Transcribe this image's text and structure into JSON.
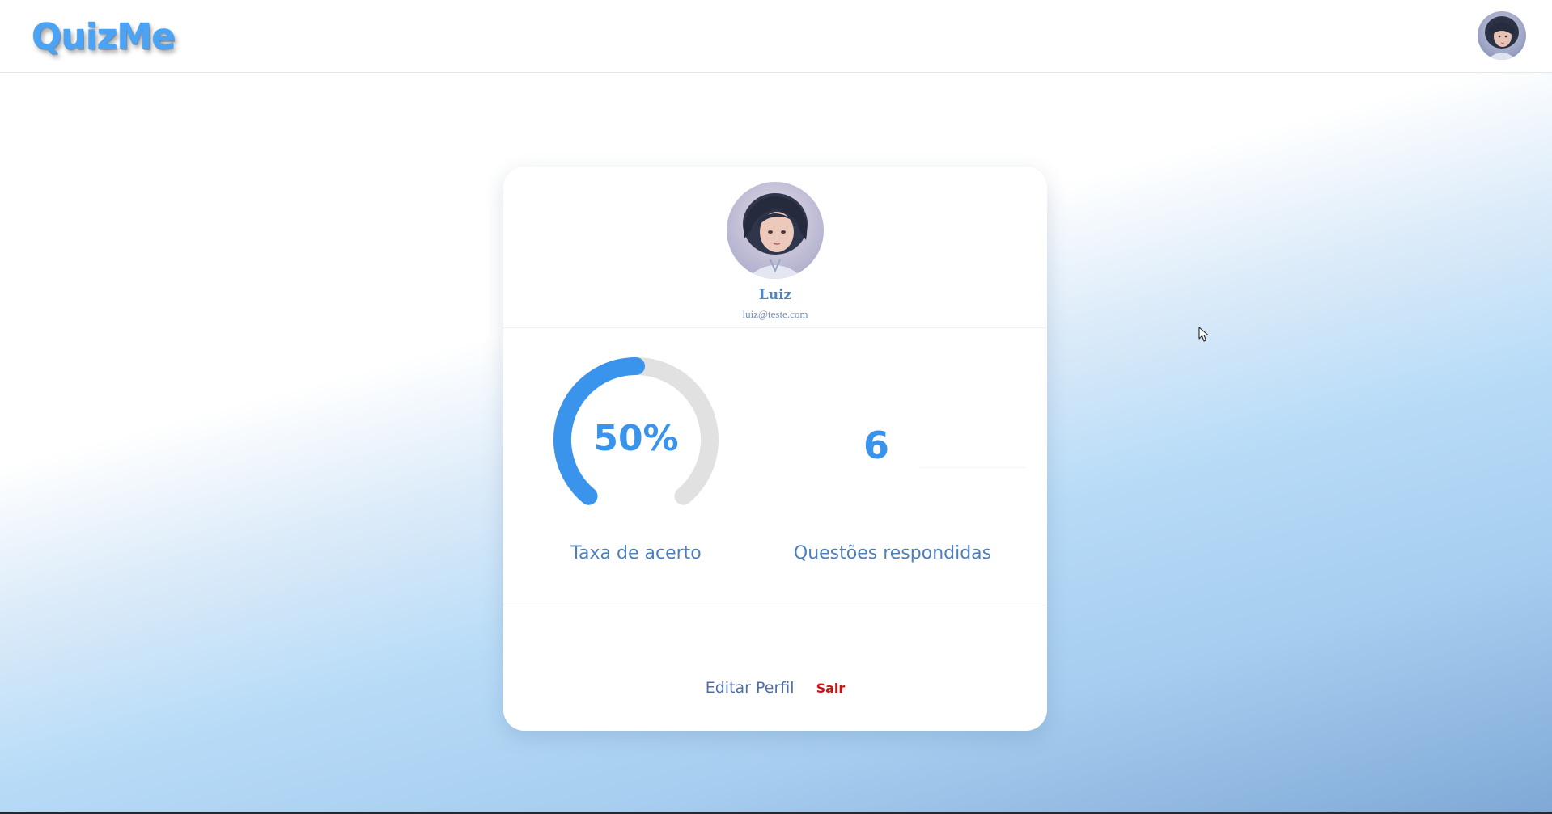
{
  "header": {
    "logo_text": "QuizMe",
    "avatar_icon": "user-avatar-icon"
  },
  "profile": {
    "name": "Luiz",
    "email": "luiz@teste.com",
    "avatar_icon": "profile-avatar-icon"
  },
  "stats": {
    "accuracy": {
      "value_text": "50%",
      "fraction": 0.5,
      "label": "Taxa de acerto"
    },
    "answered": {
      "value_text": "6",
      "label": "Questões respondidas"
    }
  },
  "actions": {
    "edit_label": "Editar Perfil",
    "logout_label": "Sair"
  },
  "colors": {
    "accent": "#3a94ec",
    "gauge_track": "#e1e1e1",
    "logout": "#cc1111",
    "text_blue": "#4d7fbf"
  }
}
